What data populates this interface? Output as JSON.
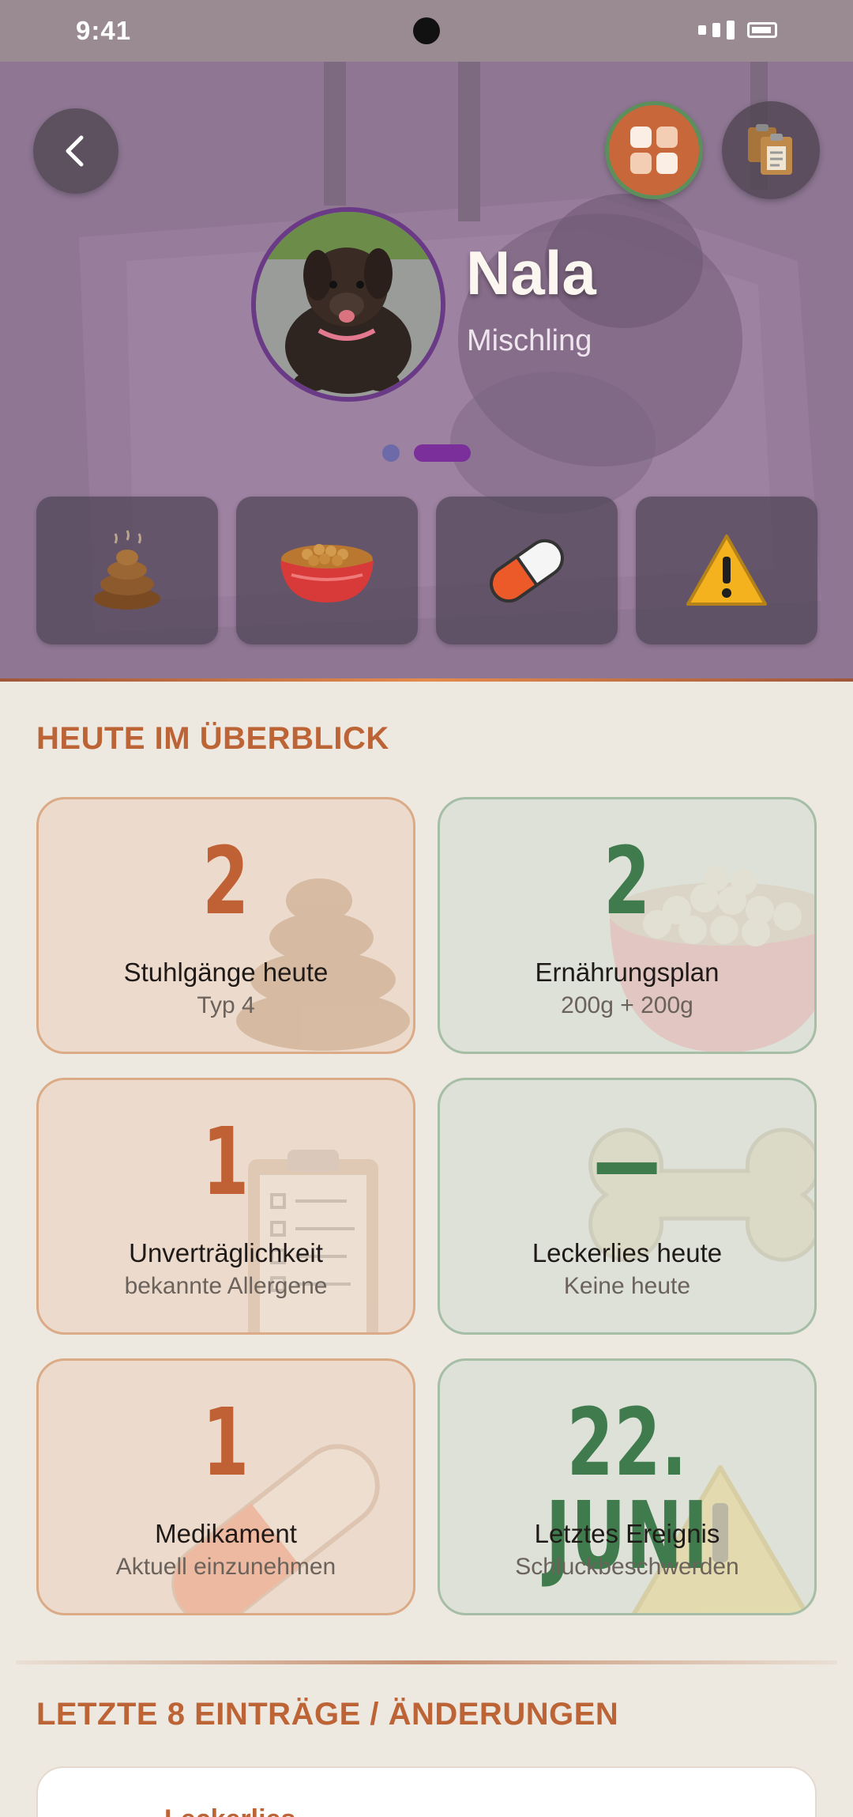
{
  "status_bar": {
    "time": "9:41"
  },
  "profile": {
    "name": "Nala",
    "breed": "Mischling"
  },
  "quick_actions": [
    {
      "icon": "poop-icon"
    },
    {
      "icon": "food-bowl-icon"
    },
    {
      "icon": "pill-icon"
    },
    {
      "icon": "warning-icon"
    }
  ],
  "overview": {
    "title": "HEUTE IM ÜBERBLICK",
    "cards": [
      {
        "value": "2",
        "label": "Stuhlgänge heute",
        "sub": "Typ 4",
        "icon": "poop-icon",
        "tone": "warm"
      },
      {
        "value": "2",
        "label": "Ernährungsplan",
        "sub": "200g + 200g",
        "icon": "food-bowl-icon",
        "tone": "green"
      },
      {
        "value": "1",
        "label": "Unverträglichkeit",
        "sub": "bekannte Allergene",
        "icon": "clipboard-icon",
        "tone": "warm"
      },
      {
        "value": "—",
        "label": "Leckerlies heute",
        "sub": "Keine heute",
        "icon": "bone-icon",
        "tone": "green"
      },
      {
        "value": "1",
        "label": "Medikament",
        "sub": "Aktuell einzunehmen",
        "icon": "pill-icon",
        "tone": "warm"
      },
      {
        "value": "22. JUNI",
        "label": "Letztes Ereignis",
        "sub": "Schluckbeschwerden",
        "icon": "warning-icon",
        "tone": "green"
      }
    ]
  },
  "entries": {
    "title": "LETZTE 8 EINTRÄGE / ÄNDERUNGEN",
    "first_item_label": "Leckerlies"
  },
  "colors": {
    "accent": "#bd6437",
    "green": "#3f7b4c",
    "purple": "#7a2f9a",
    "background": "#ede8e0"
  }
}
